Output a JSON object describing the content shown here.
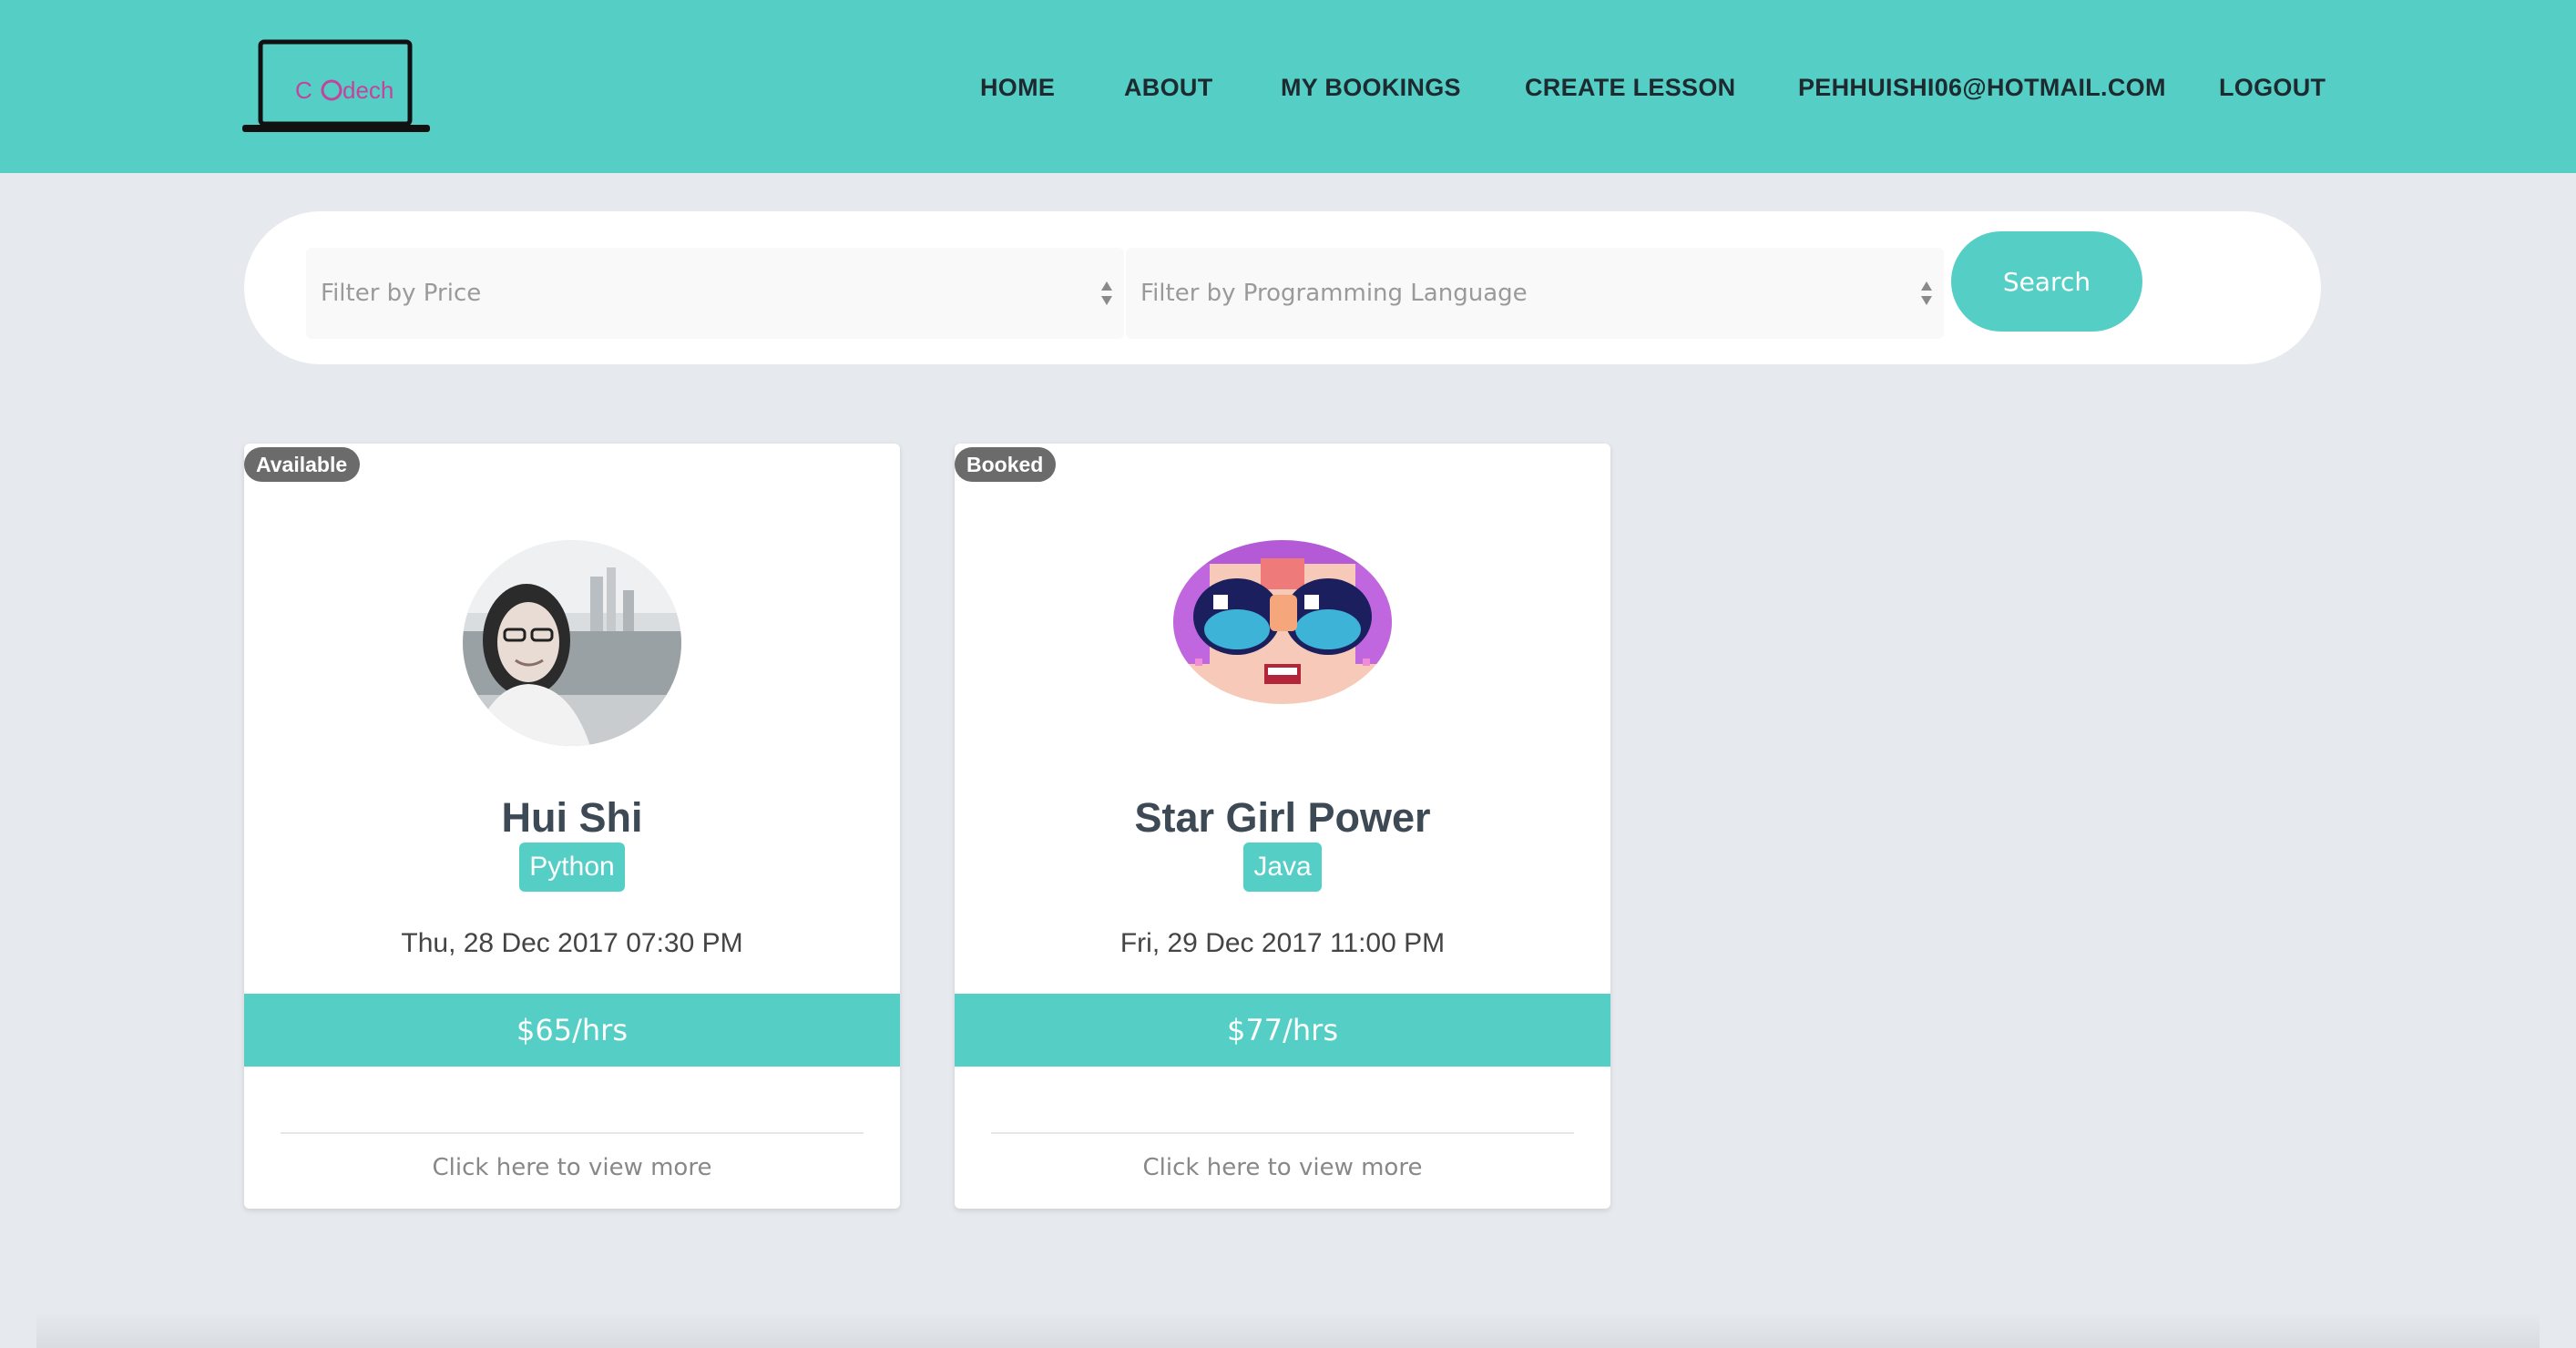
{
  "brand": {
    "logo_text": "C dech",
    "accent_color": "#55cec5",
    "logo_text_color": "#c2449c"
  },
  "nav": {
    "home": "HOME",
    "about": "ABOUT",
    "my_bookings": "MY BOOKINGS",
    "create_lesson": "CREATE LESSON",
    "user_email": "PEHHUISHI06@HOTMAIL.COM",
    "logout": "LOGOUT"
  },
  "filters": {
    "price_placeholder": "Filter by Price",
    "language_placeholder": "Filter by Programming Language",
    "search_label": "Search"
  },
  "lessons": [
    {
      "status": "Available",
      "tutor_name": "Hui Shi",
      "language": "Python",
      "datetime": "Thu, 28 Dec 2017 07:30 PM",
      "price": "$65/hrs",
      "view_more": "Click here to view more",
      "avatar": "photo-avatar"
    },
    {
      "status": "Booked",
      "tutor_name": "Star Girl Power",
      "language": "Java",
      "datetime": "Fri, 29 Dec 2017 11:00 PM",
      "price": "$77/hrs",
      "view_more": "Click here to view more",
      "avatar": "pixel-art-avatar"
    }
  ]
}
